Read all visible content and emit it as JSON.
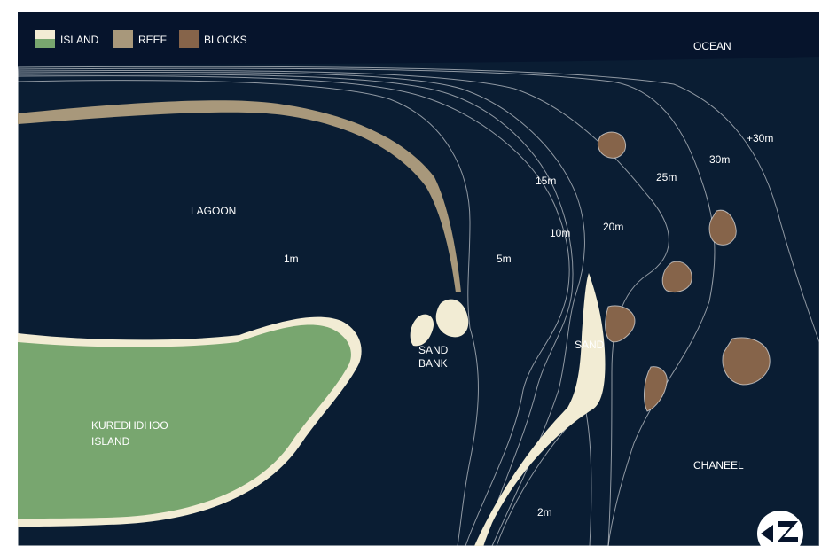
{
  "legend": {
    "island": "ISLAND",
    "reef": "REEF",
    "blocks": "BLOCKS"
  },
  "labels": {
    "ocean": "OCEAN",
    "lagoon": "LAGOON",
    "depth_1m": "1m",
    "depth_5m": "5m",
    "depth_10m": "10m",
    "depth_15m": "15m",
    "depth_20m": "20m",
    "depth_25m": "25m",
    "depth_30m": "30m",
    "depth_30m_plus": "+30m",
    "depth_2m": "2m",
    "sand_bank_line1": "SAND",
    "sand_bank_line2": "BANK",
    "sand": "SAND",
    "island_line1": "KUREDHDHOO",
    "island_line2": "ISLAND",
    "channel": "CHANEEL"
  },
  "colors": {
    "ocean": "#06142c",
    "ocean_deep": "#0a1d33",
    "depth_30m": "#0c2a2e",
    "depth_25m": "#0f4a4c",
    "depth_20m": "#2d6f78",
    "depth_15m": "#3d8593",
    "depth_10m": "#4f9cb2",
    "depth_5m": "#63aac7",
    "lagoon": "#82c6e1",
    "island": "#78a66f",
    "sand": "#f2ecd4",
    "reef": "#a8987b",
    "blocks": "#86644a"
  }
}
